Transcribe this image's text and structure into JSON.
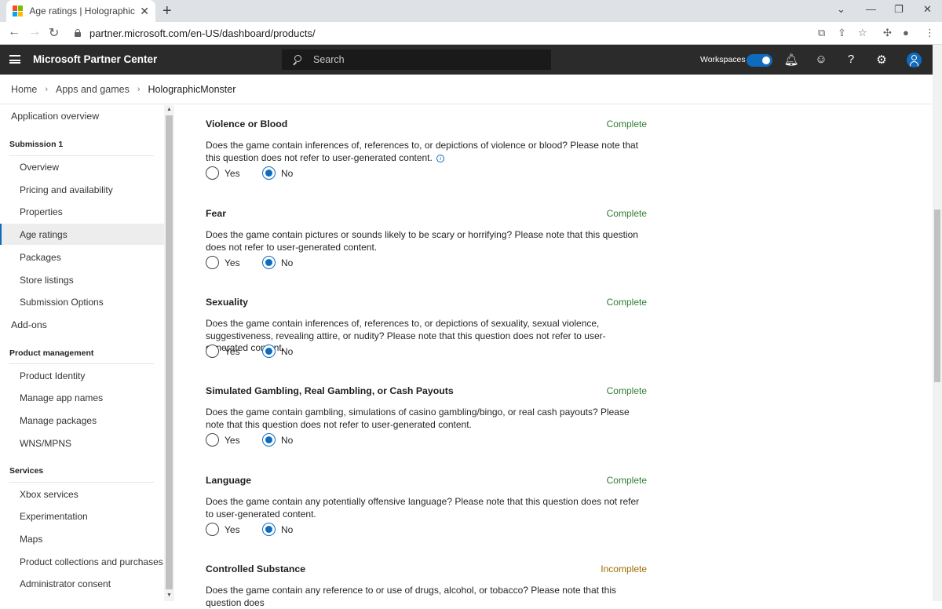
{
  "browser": {
    "tab_title": "Age ratings | HolographicMonster",
    "tab_close": "✕",
    "new_tab": "+",
    "url": "partner.microsoft.com/en-US/dashboard/products/"
  },
  "header": {
    "app_title": "Microsoft Partner Center",
    "search_placeholder": "Search",
    "workspaces_label": "Workspaces",
    "workspaces_enabled": true
  },
  "breadcrumb": {
    "items": [
      "Home",
      "Apps and games"
    ],
    "current": "HolographicMonster",
    "separator": "›"
  },
  "sidebar": {
    "application_overview": "Application overview",
    "submission_header": "Submission 1",
    "submission_items": [
      "Overview",
      "Pricing and availability",
      "Properties",
      "Age ratings",
      "Packages",
      "Store listings",
      "Submission Options"
    ],
    "selected": "Age ratings",
    "addons": "Add-ons",
    "product_management_header": "Product management",
    "product_management_items": [
      "Product Identity",
      "Manage app names",
      "Manage packages",
      "WNS/MPNS"
    ],
    "services_header": "Services",
    "services_items": [
      "Xbox services",
      "Experimentation",
      "Maps",
      "Product collections and purchases",
      "Administrator consent"
    ]
  },
  "options": {
    "yes": "Yes",
    "no": "No"
  },
  "sections": [
    {
      "title": "Violence or Blood",
      "status": "Complete",
      "question": "Does the game contain inferences of, references to, or depictions of violence or blood? Please note that this question does not refer to user-generated content.",
      "info": "i",
      "answer": "No"
    },
    {
      "title": "Fear",
      "status": "Complete",
      "question": "Does the game contain pictures or sounds likely to be scary or horrifying? Please note that this question does not refer to user-generated content.",
      "answer": "No"
    },
    {
      "title": "Sexuality",
      "status": "Complete",
      "question": "Does the game contain inferences of, references to, or depictions of sexuality, sexual violence, suggestiveness, revealing attire, or nudity? Please note that this question does not refer to user-generated content.",
      "answer": "No"
    },
    {
      "title": "Simulated Gambling, Real Gambling, or Cash Payouts",
      "status": "Complete",
      "question": "Does the game contain gambling, simulations of casino gambling/bingo, or real cash payouts? Please note that this question does not refer to user-generated content.",
      "answer": "No"
    },
    {
      "title": "Language",
      "status": "Complete",
      "question": "Does the game contain any potentially offensive language? Please note that this question does not refer to user-generated content.",
      "answer": "No"
    },
    {
      "title": "Controlled Substance",
      "status": "Incomplete",
      "question": "Does the game contain any reference to or use of drugs, alcohol, or tobacco? Please note that this question does",
      "answer": null
    }
  ],
  "colors": {
    "accent": "#0f6cbd",
    "complete": "#2e7d32",
    "incomplete": "#a06a00",
    "header_bg": "#2b2b2b"
  }
}
